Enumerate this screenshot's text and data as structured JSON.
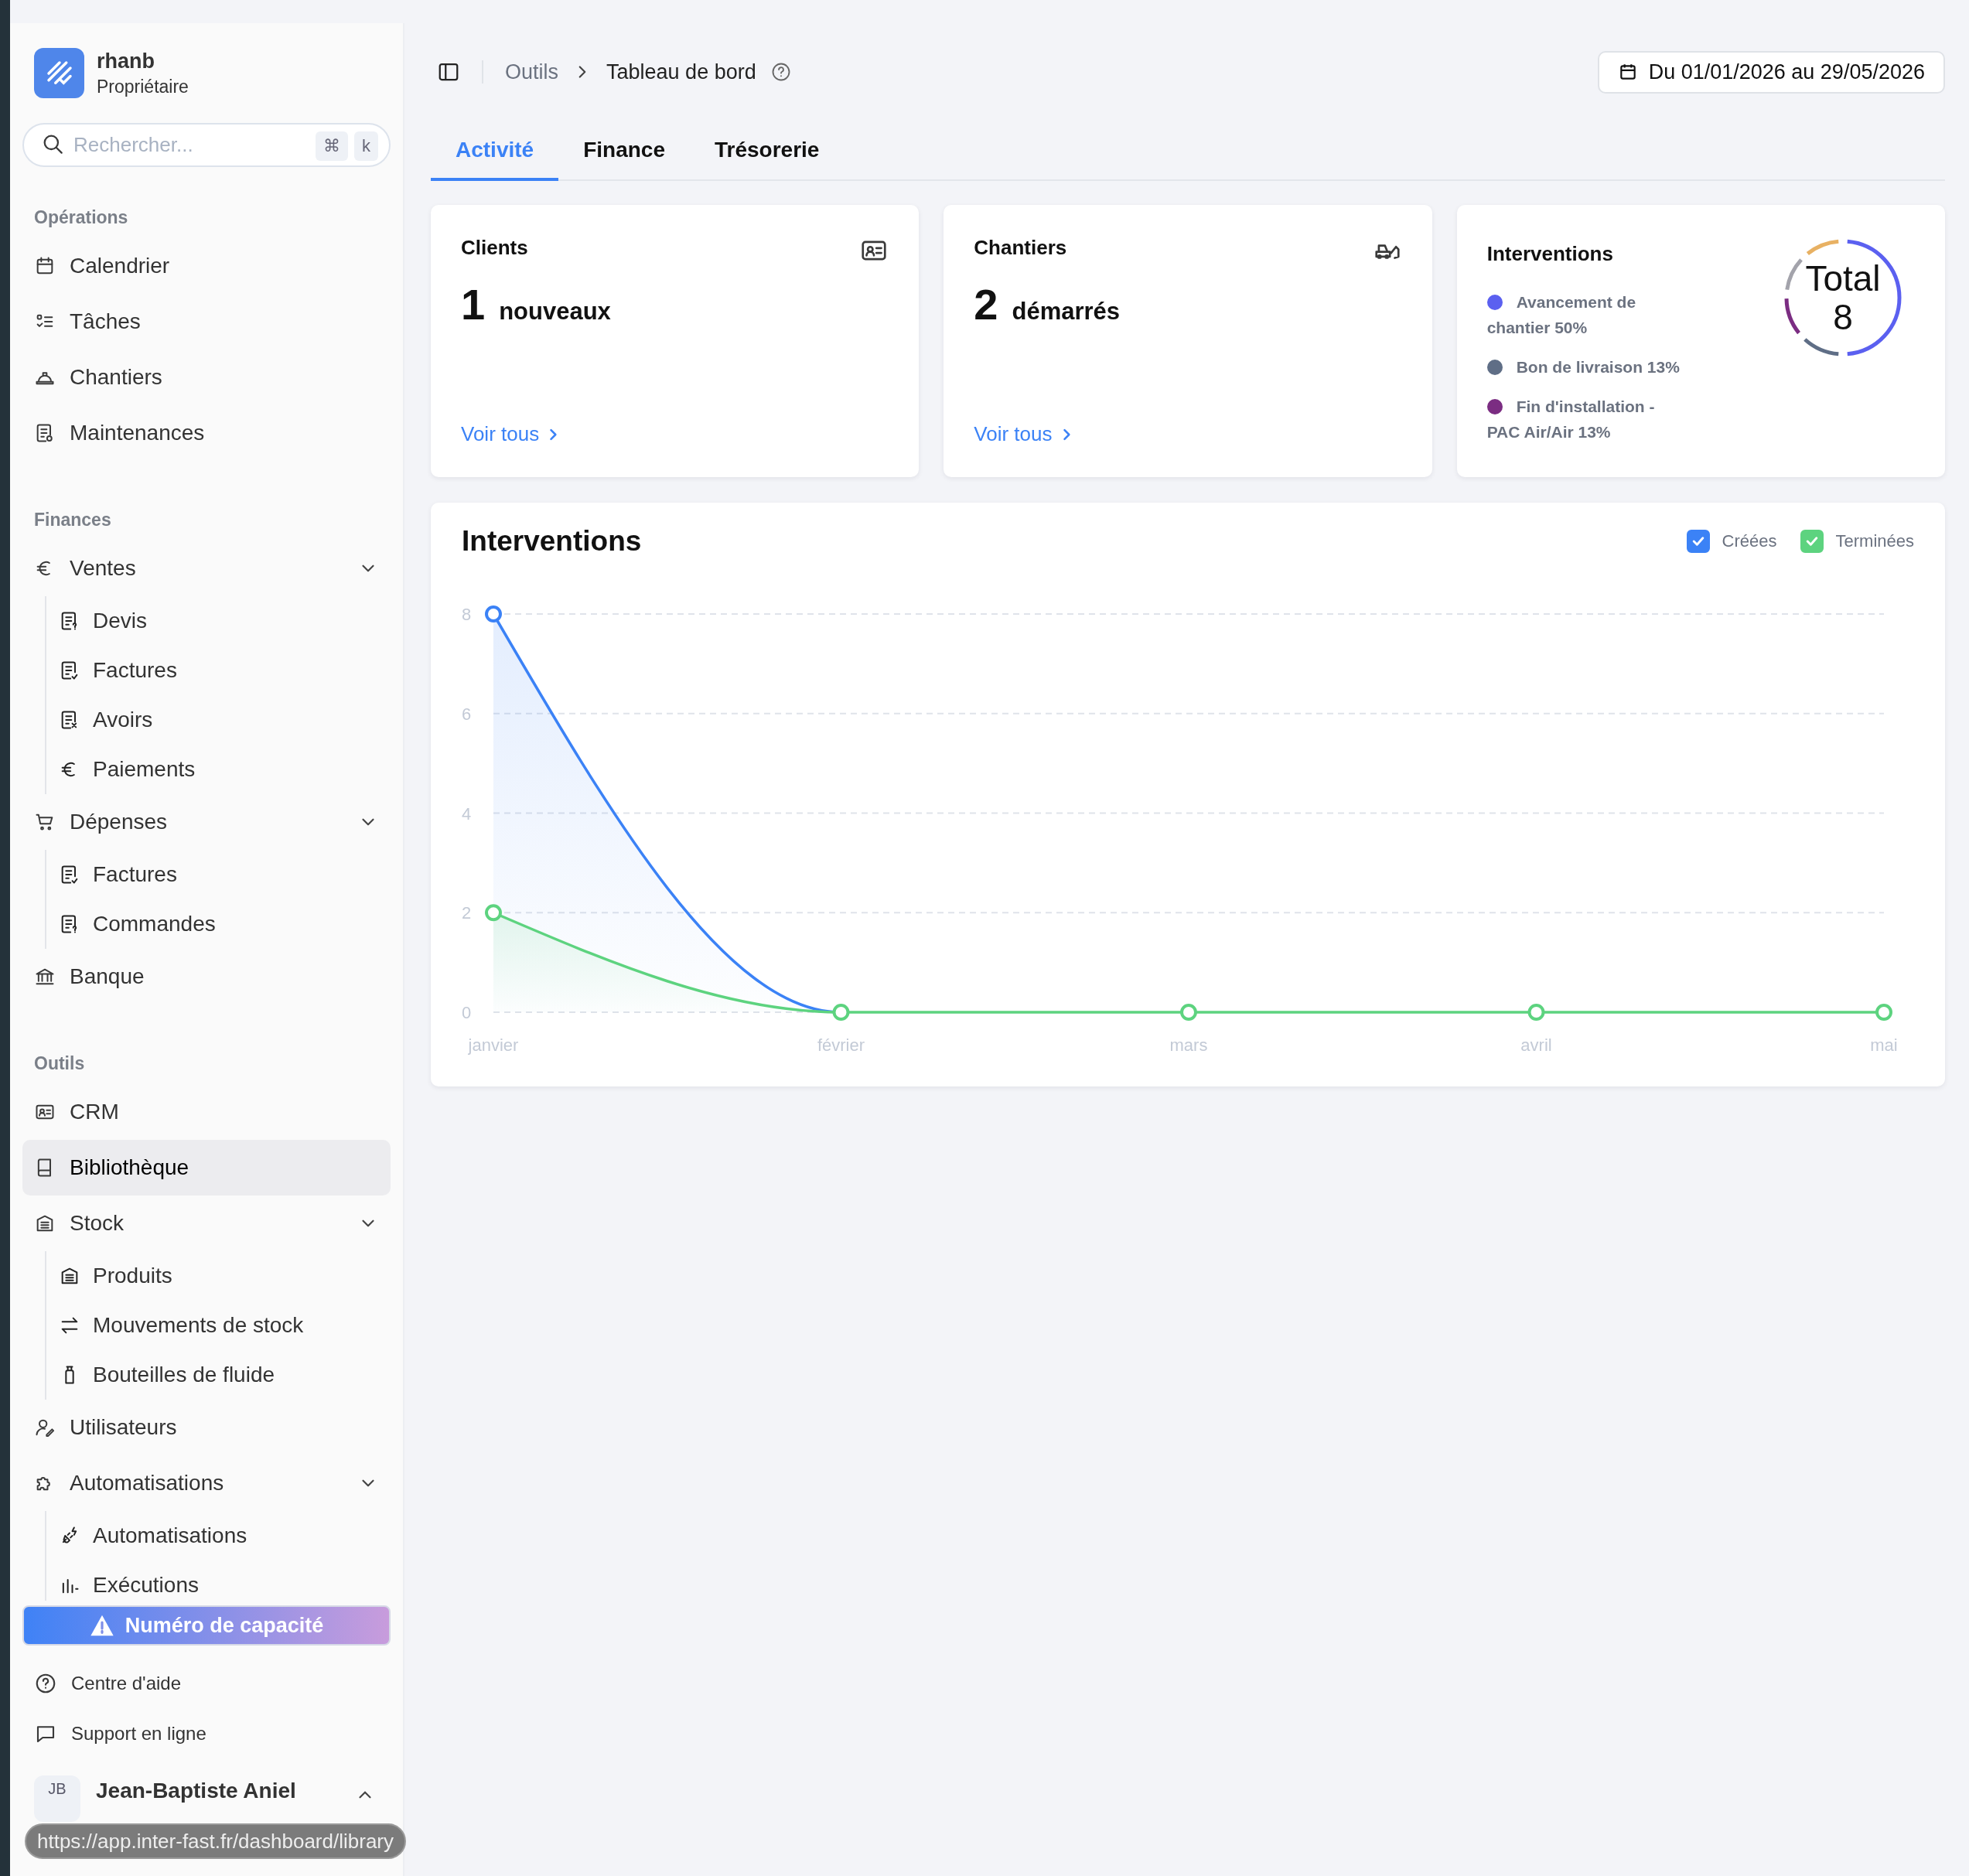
{
  "sidebar": {
    "brand": {
      "name": "rhanb",
      "role": "Propriétaire"
    },
    "search": {
      "placeholder": "Rechercher...",
      "shortcut_keys": [
        "⌘",
        "k"
      ]
    },
    "sections": [
      {
        "title": "Opérations",
        "items": [
          {
            "label": "Calendrier",
            "selected": false
          },
          {
            "label": "Tâches",
            "selected": false
          },
          {
            "label": "Chantiers",
            "selected": false
          },
          {
            "label": "Maintenances",
            "selected": false
          }
        ]
      },
      {
        "title": "Finances",
        "items": [
          {
            "label": "Ventes",
            "selected": false,
            "expanded": true,
            "children": [
              {
                "label": "Devis",
                "selected": false
              },
              {
                "label": "Factures",
                "selected": false
              },
              {
                "label": "Avoirs",
                "selected": false
              },
              {
                "label": "Paiements",
                "selected": false
              }
            ]
          },
          {
            "label": "Dépenses",
            "selected": false,
            "expanded": true,
            "children": [
              {
                "label": "Factures",
                "selected": false
              },
              {
                "label": "Commandes",
                "selected": false
              }
            ]
          },
          {
            "label": "Banque",
            "selected": false
          }
        ]
      },
      {
        "title": "Outils",
        "items": [
          {
            "label": "CRM",
            "selected": false
          },
          {
            "label": "Bibliothèque",
            "selected": true
          },
          {
            "label": "Stock",
            "selected": false,
            "expanded": true,
            "children": [
              {
                "label": "Produits",
                "selected": false
              },
              {
                "label": "Mouvements de stock",
                "selected": false
              },
              {
                "label": "Bouteilles de fluide",
                "selected": false
              }
            ]
          },
          {
            "label": "Utilisateurs",
            "selected": false
          },
          {
            "label": "Automatisations",
            "selected": false,
            "expanded": true,
            "children": [
              {
                "label": "Automatisations",
                "selected": false
              },
              {
                "label": "Exécutions",
                "selected": false
              }
            ]
          }
        ]
      }
    ],
    "capacity_button": {
      "label": "Numéro de capacité"
    },
    "help_links": [
      {
        "label": "Centre d'aide"
      },
      {
        "label": "Support en ligne"
      }
    ],
    "user": {
      "initials": "JB",
      "name": "Jean-Baptiste Aniel"
    }
  },
  "status_tooltip": "https://app.inter-fast.fr/dashboard/library",
  "breadcrumb": [
    "Outils",
    "Tableau de bord"
  ],
  "date_range_button": {
    "label": "Du 01/01/2026 au 29/05/2026"
  },
  "tabs": [
    {
      "label": "Activité",
      "selected": true
    },
    {
      "label": "Finance",
      "selected": false
    },
    {
      "label": "Trésorerie",
      "selected": false
    }
  ],
  "stat_cards": [
    {
      "title": "Clients",
      "count": "1",
      "caption": "nouveaux",
      "link": "Voir tous"
    },
    {
      "title": "Chantiers",
      "count": "2",
      "caption": "démarrés",
      "link": "Voir tous"
    }
  ],
  "interventions_card": {
    "title": "Interventions",
    "legend": [
      {
        "label": "Avancement de chantier 50%",
        "color": "#5b60f0"
      },
      {
        "label": "Bon de livraison 13%",
        "color": "#5f6e86"
      },
      {
        "label": "Fin d'installation - PAC Air/Air 13%",
        "color": "#7b2d82"
      }
    ],
    "total_label": "Total",
    "total": "8"
  },
  "chart_card": {
    "title": "Interventions",
    "legend": [
      {
        "checked": true
      },
      {
        "checked": true
      }
    ],
    "chart_data": {
      "type": "area",
      "categories": [
        "janvier",
        "février",
        "mars",
        "avril",
        "mai"
      ],
      "series": [
        {
          "name": "Créées",
          "color": "#3b82f6",
          "marker": "o",
          "values": [
            8,
            0,
            null,
            null,
            null
          ]
        },
        {
          "name": "Terminées",
          "color": "#5dd37f",
          "marker": "o",
          "values": [
            2,
            0,
            0,
            0,
            0
          ]
        }
      ],
      "ylim": [
        0,
        8
      ],
      "yticks": [
        0,
        2,
        4,
        6,
        8
      ],
      "grid": true
    }
  }
}
